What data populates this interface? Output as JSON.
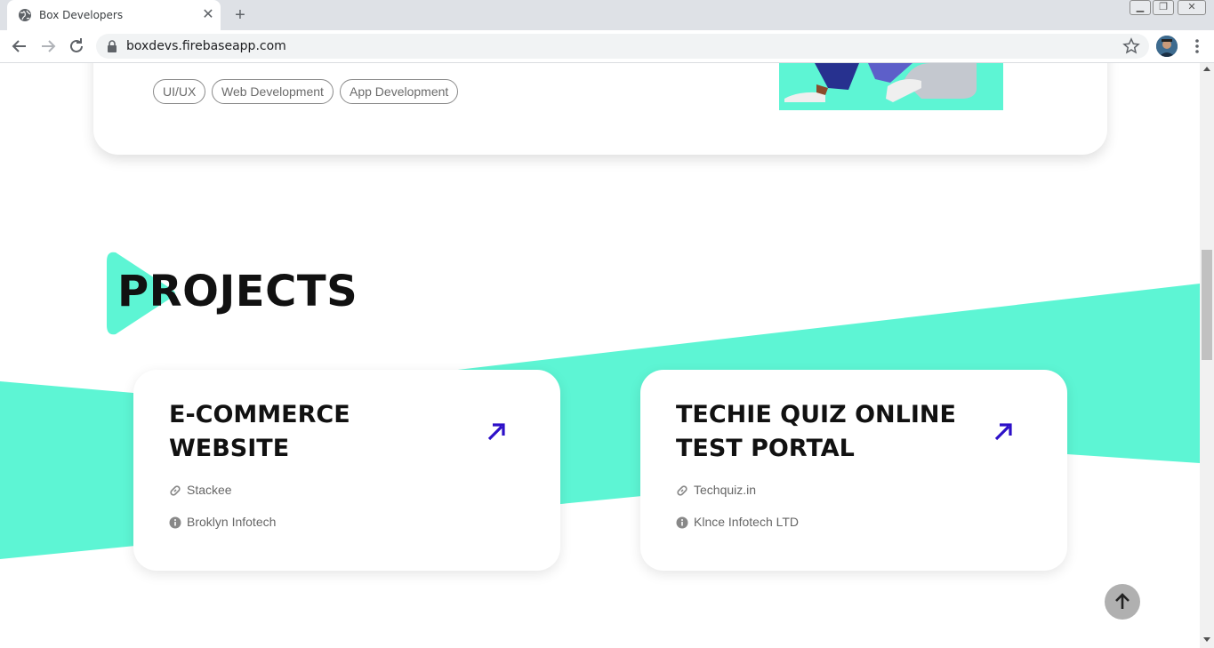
{
  "browser": {
    "tab_title": "Box Developers",
    "url": "boxdevs.firebaseapp.com",
    "new_tab_label": "+",
    "close_tab_label": "✕"
  },
  "page": {
    "tags": [
      "UI/UX",
      "Web Development",
      "App Development"
    ],
    "section_title": "PROJECTS",
    "accent_color": "#5df5d4",
    "arrow_color": "#2d10c8",
    "projects": [
      {
        "title": "E-COMMERCE WEBSITE",
        "link_text": "Stackee",
        "company": "Broklyn Infotech"
      },
      {
        "title": "TECHIE QUIZ ONLINE TEST PORTAL",
        "link_text": "Techquiz.in",
        "company": "Klnce Infotech LTD"
      }
    ]
  },
  "icons": {
    "favicon": "globe-icon",
    "link": "link-icon",
    "info": "info-circle-icon",
    "arrow": "arrow-up-right-icon",
    "back_to_top": "arrow-up-icon"
  }
}
